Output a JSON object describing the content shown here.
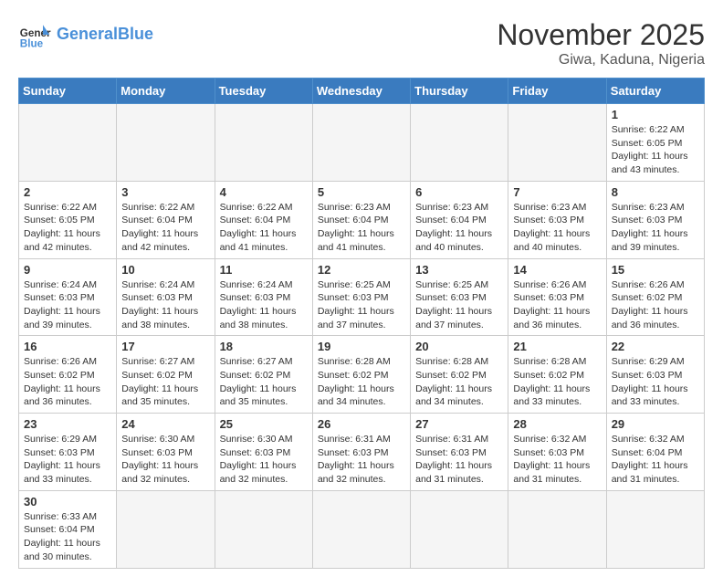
{
  "header": {
    "logo_general": "General",
    "logo_blue": "Blue",
    "title": "November 2025",
    "subtitle": "Giwa, Kaduna, Nigeria"
  },
  "days_of_week": [
    "Sunday",
    "Monday",
    "Tuesday",
    "Wednesday",
    "Thursday",
    "Friday",
    "Saturday"
  ],
  "weeks": [
    [
      {
        "day": "",
        "info": "",
        "empty": true
      },
      {
        "day": "",
        "info": "",
        "empty": true
      },
      {
        "day": "",
        "info": "",
        "empty": true
      },
      {
        "day": "",
        "info": "",
        "empty": true
      },
      {
        "day": "",
        "info": "",
        "empty": true
      },
      {
        "day": "",
        "info": "",
        "empty": true
      },
      {
        "day": "1",
        "info": "Sunrise: 6:22 AM\nSunset: 6:05 PM\nDaylight: 11 hours and 43 minutes."
      }
    ],
    [
      {
        "day": "2",
        "info": "Sunrise: 6:22 AM\nSunset: 6:05 PM\nDaylight: 11 hours and 42 minutes."
      },
      {
        "day": "3",
        "info": "Sunrise: 6:22 AM\nSunset: 6:04 PM\nDaylight: 11 hours and 42 minutes."
      },
      {
        "day": "4",
        "info": "Sunrise: 6:22 AM\nSunset: 6:04 PM\nDaylight: 11 hours and 41 minutes."
      },
      {
        "day": "5",
        "info": "Sunrise: 6:23 AM\nSunset: 6:04 PM\nDaylight: 11 hours and 41 minutes."
      },
      {
        "day": "6",
        "info": "Sunrise: 6:23 AM\nSunset: 6:04 PM\nDaylight: 11 hours and 40 minutes."
      },
      {
        "day": "7",
        "info": "Sunrise: 6:23 AM\nSunset: 6:03 PM\nDaylight: 11 hours and 40 minutes."
      },
      {
        "day": "8",
        "info": "Sunrise: 6:23 AM\nSunset: 6:03 PM\nDaylight: 11 hours and 39 minutes."
      }
    ],
    [
      {
        "day": "9",
        "info": "Sunrise: 6:24 AM\nSunset: 6:03 PM\nDaylight: 11 hours and 39 minutes."
      },
      {
        "day": "10",
        "info": "Sunrise: 6:24 AM\nSunset: 6:03 PM\nDaylight: 11 hours and 38 minutes."
      },
      {
        "day": "11",
        "info": "Sunrise: 6:24 AM\nSunset: 6:03 PM\nDaylight: 11 hours and 38 minutes."
      },
      {
        "day": "12",
        "info": "Sunrise: 6:25 AM\nSunset: 6:03 PM\nDaylight: 11 hours and 37 minutes."
      },
      {
        "day": "13",
        "info": "Sunrise: 6:25 AM\nSunset: 6:03 PM\nDaylight: 11 hours and 37 minutes."
      },
      {
        "day": "14",
        "info": "Sunrise: 6:26 AM\nSunset: 6:03 PM\nDaylight: 11 hours and 36 minutes."
      },
      {
        "day": "15",
        "info": "Sunrise: 6:26 AM\nSunset: 6:02 PM\nDaylight: 11 hours and 36 minutes."
      }
    ],
    [
      {
        "day": "16",
        "info": "Sunrise: 6:26 AM\nSunset: 6:02 PM\nDaylight: 11 hours and 36 minutes."
      },
      {
        "day": "17",
        "info": "Sunrise: 6:27 AM\nSunset: 6:02 PM\nDaylight: 11 hours and 35 minutes."
      },
      {
        "day": "18",
        "info": "Sunrise: 6:27 AM\nSunset: 6:02 PM\nDaylight: 11 hours and 35 minutes."
      },
      {
        "day": "19",
        "info": "Sunrise: 6:28 AM\nSunset: 6:02 PM\nDaylight: 11 hours and 34 minutes."
      },
      {
        "day": "20",
        "info": "Sunrise: 6:28 AM\nSunset: 6:02 PM\nDaylight: 11 hours and 34 minutes."
      },
      {
        "day": "21",
        "info": "Sunrise: 6:28 AM\nSunset: 6:02 PM\nDaylight: 11 hours and 33 minutes."
      },
      {
        "day": "22",
        "info": "Sunrise: 6:29 AM\nSunset: 6:03 PM\nDaylight: 11 hours and 33 minutes."
      }
    ],
    [
      {
        "day": "23",
        "info": "Sunrise: 6:29 AM\nSunset: 6:03 PM\nDaylight: 11 hours and 33 minutes."
      },
      {
        "day": "24",
        "info": "Sunrise: 6:30 AM\nSunset: 6:03 PM\nDaylight: 11 hours and 32 minutes."
      },
      {
        "day": "25",
        "info": "Sunrise: 6:30 AM\nSunset: 6:03 PM\nDaylight: 11 hours and 32 minutes."
      },
      {
        "day": "26",
        "info": "Sunrise: 6:31 AM\nSunset: 6:03 PM\nDaylight: 11 hours and 32 minutes."
      },
      {
        "day": "27",
        "info": "Sunrise: 6:31 AM\nSunset: 6:03 PM\nDaylight: 11 hours and 31 minutes."
      },
      {
        "day": "28",
        "info": "Sunrise: 6:32 AM\nSunset: 6:03 PM\nDaylight: 11 hours and 31 minutes."
      },
      {
        "day": "29",
        "info": "Sunrise: 6:32 AM\nSunset: 6:04 PM\nDaylight: 11 hours and 31 minutes."
      }
    ],
    [
      {
        "day": "30",
        "info": "Sunrise: 6:33 AM\nSunset: 6:04 PM\nDaylight: 11 hours and 30 minutes."
      },
      {
        "day": "",
        "info": "",
        "empty": true
      },
      {
        "day": "",
        "info": "",
        "empty": true
      },
      {
        "day": "",
        "info": "",
        "empty": true
      },
      {
        "day": "",
        "info": "",
        "empty": true
      },
      {
        "day": "",
        "info": "",
        "empty": true
      },
      {
        "day": "",
        "info": "",
        "empty": true
      }
    ]
  ]
}
